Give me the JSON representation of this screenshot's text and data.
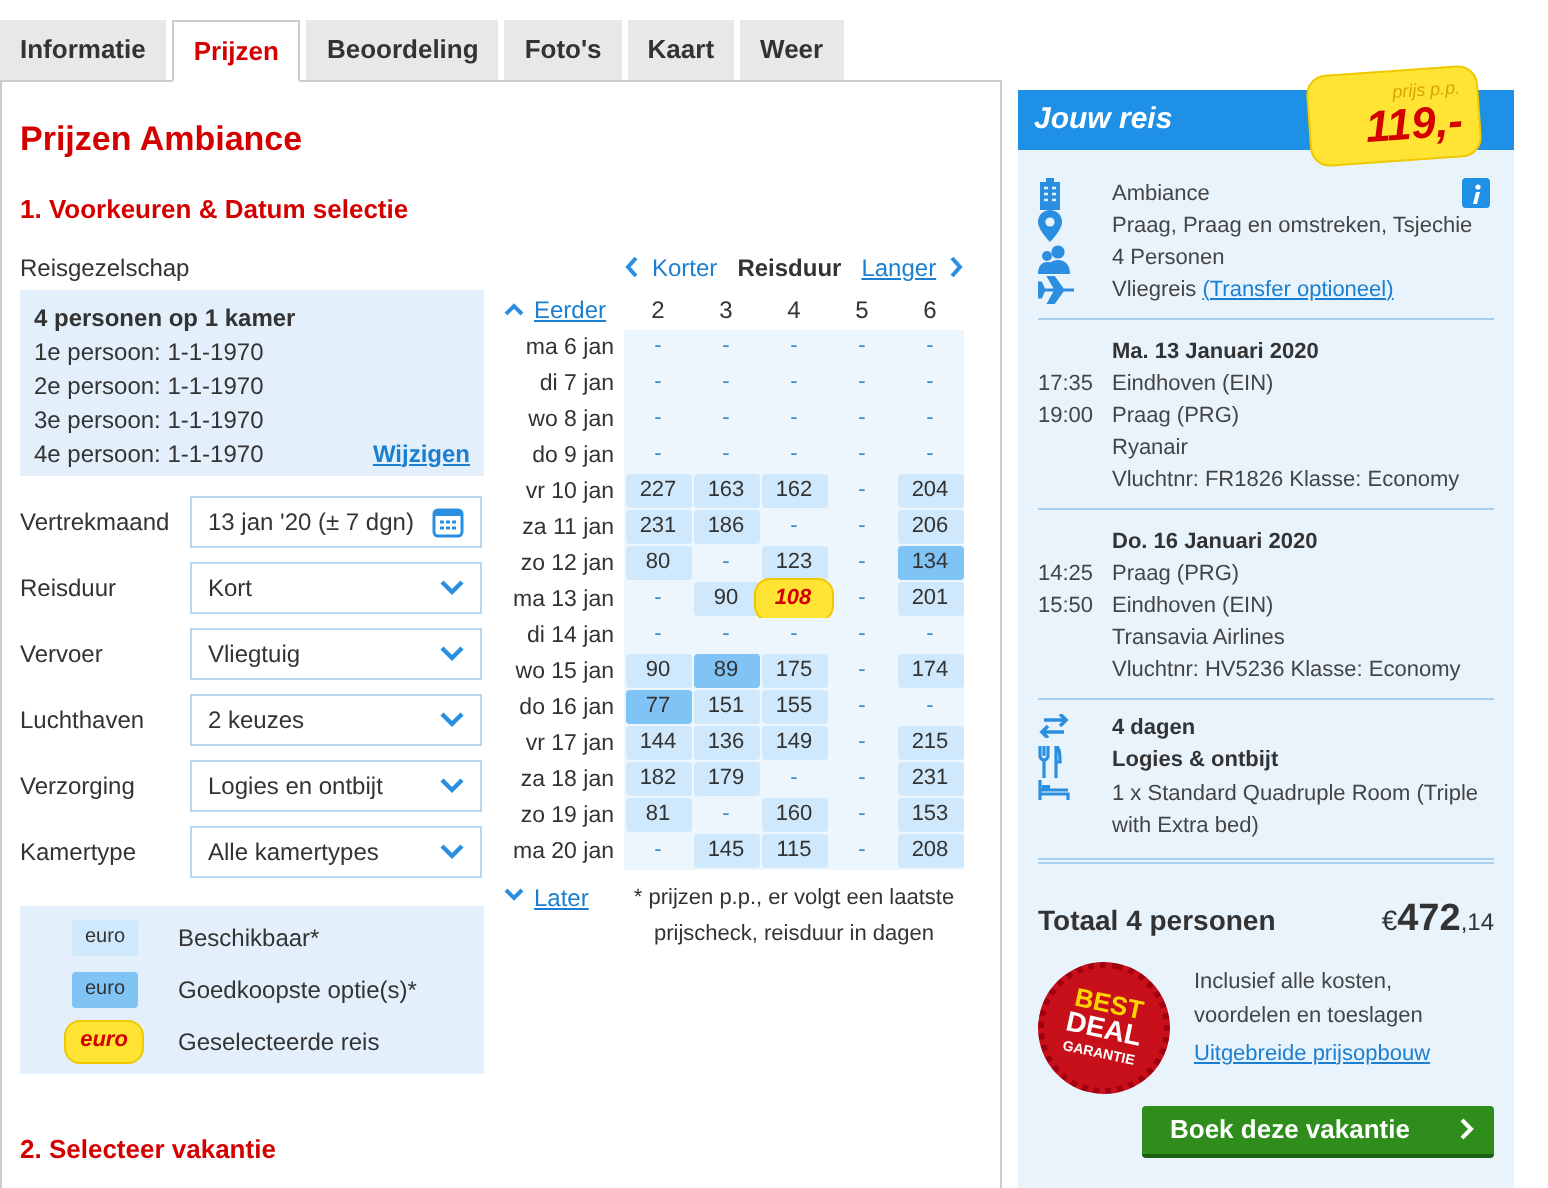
{
  "tabs": [
    {
      "label": "Informatie",
      "selected": false
    },
    {
      "label": "Prijzen",
      "selected": true
    },
    {
      "label": "Beoordeling",
      "selected": false
    },
    {
      "label": "Foto's",
      "selected": false
    },
    {
      "label": "Kaart",
      "selected": false
    },
    {
      "label": "Weer",
      "selected": false
    }
  ],
  "title": "Prijzen Ambiance",
  "section_1": "1. Voorkeuren & Datum selectie",
  "party": {
    "label": "Reisgezelschap",
    "heading": "4 personen op 1 kamer",
    "persons": [
      "1e persoon: 1-1-1970",
      "2e persoon: 1-1-1970",
      "3e persoon: 1-1-1970",
      "4e persoon: 1-1-1970"
    ],
    "link": "Wijzigen"
  },
  "fields": [
    {
      "label": "Vertrekmaand",
      "value": "13 jan '20 (± 7 dgn)",
      "kind": "date"
    },
    {
      "label": "Reisduur",
      "value": "Kort",
      "kind": "select"
    },
    {
      "label": "Vervoer",
      "value": "Vliegtuig",
      "kind": "select"
    },
    {
      "label": "Luchthaven",
      "value": "2 keuzes",
      "kind": "select"
    },
    {
      "label": "Verzorging",
      "value": "Logies en ontbijt",
      "kind": "select"
    },
    {
      "label": "Kamertype",
      "value": "Alle kamertypes",
      "kind": "select"
    }
  ],
  "legend": [
    {
      "sample": "euro",
      "label": "Beschikbaar*",
      "kind": "available"
    },
    {
      "sample": "euro",
      "label": "Goedkoopste optie(s)*",
      "kind": "cheapest"
    },
    {
      "sample": "euro",
      "label": "Geselecteerde reis",
      "kind": "selected"
    }
  ],
  "matrix": {
    "shorter": "Korter",
    "heading": "Reisduur",
    "longer": "Langer",
    "earlier": "Eerder",
    "later": "Later",
    "columns": [
      "2",
      "3",
      "4",
      "5",
      "6"
    ],
    "rows": [
      {
        "date": "ma 6 jan",
        "cells": [
          {
            "text": "-",
            "kind": "none"
          },
          {
            "text": "-",
            "kind": "none"
          },
          {
            "text": "-",
            "kind": "none"
          },
          {
            "text": "-",
            "kind": "none"
          },
          {
            "text": "-",
            "kind": "none"
          }
        ]
      },
      {
        "date": "di 7 jan",
        "cells": [
          {
            "text": "-",
            "kind": "none"
          },
          {
            "text": "-",
            "kind": "none"
          },
          {
            "text": "-",
            "kind": "none"
          },
          {
            "text": "-",
            "kind": "none"
          },
          {
            "text": "-",
            "kind": "none"
          }
        ]
      },
      {
        "date": "wo 8 jan",
        "cells": [
          {
            "text": "-",
            "kind": "none"
          },
          {
            "text": "-",
            "kind": "none"
          },
          {
            "text": "-",
            "kind": "none"
          },
          {
            "text": "-",
            "kind": "none"
          },
          {
            "text": "-",
            "kind": "none"
          }
        ]
      },
      {
        "date": "do 9 jan",
        "cells": [
          {
            "text": "-",
            "kind": "none"
          },
          {
            "text": "-",
            "kind": "none"
          },
          {
            "text": "-",
            "kind": "none"
          },
          {
            "text": "-",
            "kind": "none"
          },
          {
            "text": "-",
            "kind": "none"
          }
        ]
      },
      {
        "date": "vr 10 jan",
        "cells": [
          {
            "text": "227",
            "kind": "available"
          },
          {
            "text": "163",
            "kind": "available"
          },
          {
            "text": "162",
            "kind": "available"
          },
          {
            "text": "-",
            "kind": "none"
          },
          {
            "text": "204",
            "kind": "available"
          }
        ]
      },
      {
        "date": "za 11 jan",
        "cells": [
          {
            "text": "231",
            "kind": "available"
          },
          {
            "text": "186",
            "kind": "available"
          },
          {
            "text": "-",
            "kind": "none"
          },
          {
            "text": "-",
            "kind": "none"
          },
          {
            "text": "206",
            "kind": "available"
          }
        ]
      },
      {
        "date": "zo 12 jan",
        "cells": [
          {
            "text": "80",
            "kind": "available"
          },
          {
            "text": "-",
            "kind": "none"
          },
          {
            "text": "123",
            "kind": "available"
          },
          {
            "text": "-",
            "kind": "none"
          },
          {
            "text": "134",
            "kind": "cheapest"
          }
        ]
      },
      {
        "date": "ma 13 jan",
        "cells": [
          {
            "text": "-",
            "kind": "none"
          },
          {
            "text": "90",
            "kind": "available"
          },
          {
            "text": "108",
            "kind": "selected"
          },
          {
            "text": "-",
            "kind": "none"
          },
          {
            "text": "201",
            "kind": "available"
          }
        ]
      },
      {
        "date": "di 14 jan",
        "cells": [
          {
            "text": "-",
            "kind": "none"
          },
          {
            "text": "-",
            "kind": "none"
          },
          {
            "text": "-",
            "kind": "none"
          },
          {
            "text": "-",
            "kind": "none"
          },
          {
            "text": "-",
            "kind": "none"
          }
        ]
      },
      {
        "date": "wo 15 jan",
        "cells": [
          {
            "text": "90",
            "kind": "available"
          },
          {
            "text": "89",
            "kind": "cheapest"
          },
          {
            "text": "175",
            "kind": "available"
          },
          {
            "text": "-",
            "kind": "none"
          },
          {
            "text": "174",
            "kind": "available"
          }
        ]
      },
      {
        "date": "do 16 jan",
        "cells": [
          {
            "text": "77",
            "kind": "cheapest"
          },
          {
            "text": "151",
            "kind": "available"
          },
          {
            "text": "155",
            "kind": "available"
          },
          {
            "text": "-",
            "kind": "none"
          },
          {
            "text": "-",
            "kind": "none"
          }
        ]
      },
      {
        "date": "vr 17 jan",
        "cells": [
          {
            "text": "144",
            "kind": "available"
          },
          {
            "text": "136",
            "kind": "available"
          },
          {
            "text": "149",
            "kind": "available"
          },
          {
            "text": "-",
            "kind": "none"
          },
          {
            "text": "215",
            "kind": "available"
          }
        ]
      },
      {
        "date": "za 18 jan",
        "cells": [
          {
            "text": "182",
            "kind": "available"
          },
          {
            "text": "179",
            "kind": "available"
          },
          {
            "text": "-",
            "kind": "none"
          },
          {
            "text": "-",
            "kind": "none"
          },
          {
            "text": "231",
            "kind": "available"
          }
        ]
      },
      {
        "date": "zo 19 jan",
        "cells": [
          {
            "text": "81",
            "kind": "available"
          },
          {
            "text": "-",
            "kind": "none"
          },
          {
            "text": "160",
            "kind": "available"
          },
          {
            "text": "-",
            "kind": "none"
          },
          {
            "text": "153",
            "kind": "available"
          }
        ]
      },
      {
        "date": "ma 20 jan",
        "cells": [
          {
            "text": "-",
            "kind": "none"
          },
          {
            "text": "145",
            "kind": "available"
          },
          {
            "text": "115",
            "kind": "available"
          },
          {
            "text": "-",
            "kind": "none"
          },
          {
            "text": "208",
            "kind": "available"
          }
        ]
      }
    ],
    "footnote": "* prijzen p.p., er volgt een laatste prijscheck, reisduur in dagen"
  },
  "section_2": "2. Selecteer vakantie",
  "trip": {
    "title": "Jouw reis",
    "price_label": "prijs p.p.",
    "price": "119,-",
    "info": [
      {
        "kind": "hotel",
        "text": "Ambiance"
      },
      {
        "kind": "location",
        "text": "Praag, Praag en omstreken, Tsjechie"
      },
      {
        "kind": "people",
        "text": "4 Personen"
      },
      {
        "kind": "flight",
        "text": "Vliegreis",
        "link": "(Transfer optioneel)"
      }
    ],
    "flights": [
      {
        "date": "Ma. 13 Januari 2020",
        "legs": [
          {
            "time": "17:35",
            "place": "Eindhoven (EIN)"
          },
          {
            "time": "19:00",
            "place": "Praag (PRG)"
          }
        ],
        "airline": "Ryanair",
        "flight_info": "Vluchtnr: FR1826  Klasse: Economy"
      },
      {
        "date": "Do. 16 Januari 2020",
        "legs": [
          {
            "time": "14:25",
            "place": "Praag (PRG)"
          },
          {
            "time": "15:50",
            "place": "Eindhoven (EIN)"
          }
        ],
        "airline": "Transavia Airlines",
        "flight_info": "Vluchtnr: HV5236  Klasse: Economy"
      }
    ],
    "details": [
      {
        "kind": "duration",
        "text": "4 dagen"
      },
      {
        "kind": "meals",
        "text": "Logies & ontbijt"
      },
      {
        "kind": "room",
        "text": "1 x Standard Quadruple Room (Triple with Extra bed)"
      }
    ],
    "total_label": "Totaal 4 personen",
    "currency": "€",
    "amount": "472",
    "cents": ",14",
    "deal_badge": [
      "BEST",
      "DEAL",
      "GARANTIE"
    ],
    "inclusive": "Inclusief alle kosten, voordelen en toeslagen",
    "breakdown_link": "Uitgebreide prijsopbouw",
    "book_button": "Boek deze vakantie"
  }
}
